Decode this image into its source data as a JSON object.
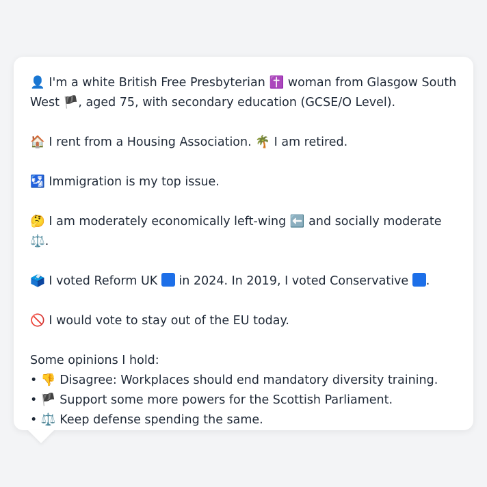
{
  "profile": {
    "identity": {
      "icon": "👤",
      "text_a": "I'm a white British Free Presbyterian",
      "icon_religion": "✝️",
      "text_b": "woman from Glasgow South West",
      "icon_flag": "🏴",
      "text_c": ", aged 75, with secondary education (GCSE/O Level)."
    },
    "housing": {
      "icon": "🏠",
      "text_a": "I rent from a Housing Association.",
      "icon_work": "🌴",
      "text_b": "I am retired."
    },
    "issue": {
      "icon": "🛂",
      "text": "Immigration is my top issue."
    },
    "ideology": {
      "icon": "🤔",
      "text_a": "I am moderately economically left-wing",
      "icon_left": "⬅️",
      "text_b": "and socially moderate",
      "icon_balance": "⚖️",
      "text_c": "."
    },
    "vote": {
      "icon": "🗳️",
      "text_a": "I voted Reform UK",
      "reform_color": "#1d6fe8",
      "text_b": "in 2024. In 2019, I voted Conservative",
      "conservative_color": "#1d6fe8",
      "text_c": "."
    },
    "eu": {
      "icon": "🚫",
      "text": "I would vote to stay out of the EU today."
    },
    "opinions": {
      "heading": "Some opinions I hold:",
      "items": [
        {
          "bullet": "•",
          "icon": "👎",
          "text": "Disagree: Workplaces should end mandatory diversity training."
        },
        {
          "bullet": "•",
          "icon": "🏴",
          "text": "Support some more powers for the Scottish Parliament."
        },
        {
          "bullet": "•",
          "icon": "⚖️",
          "text": "Keep defense spending the same."
        }
      ]
    }
  }
}
